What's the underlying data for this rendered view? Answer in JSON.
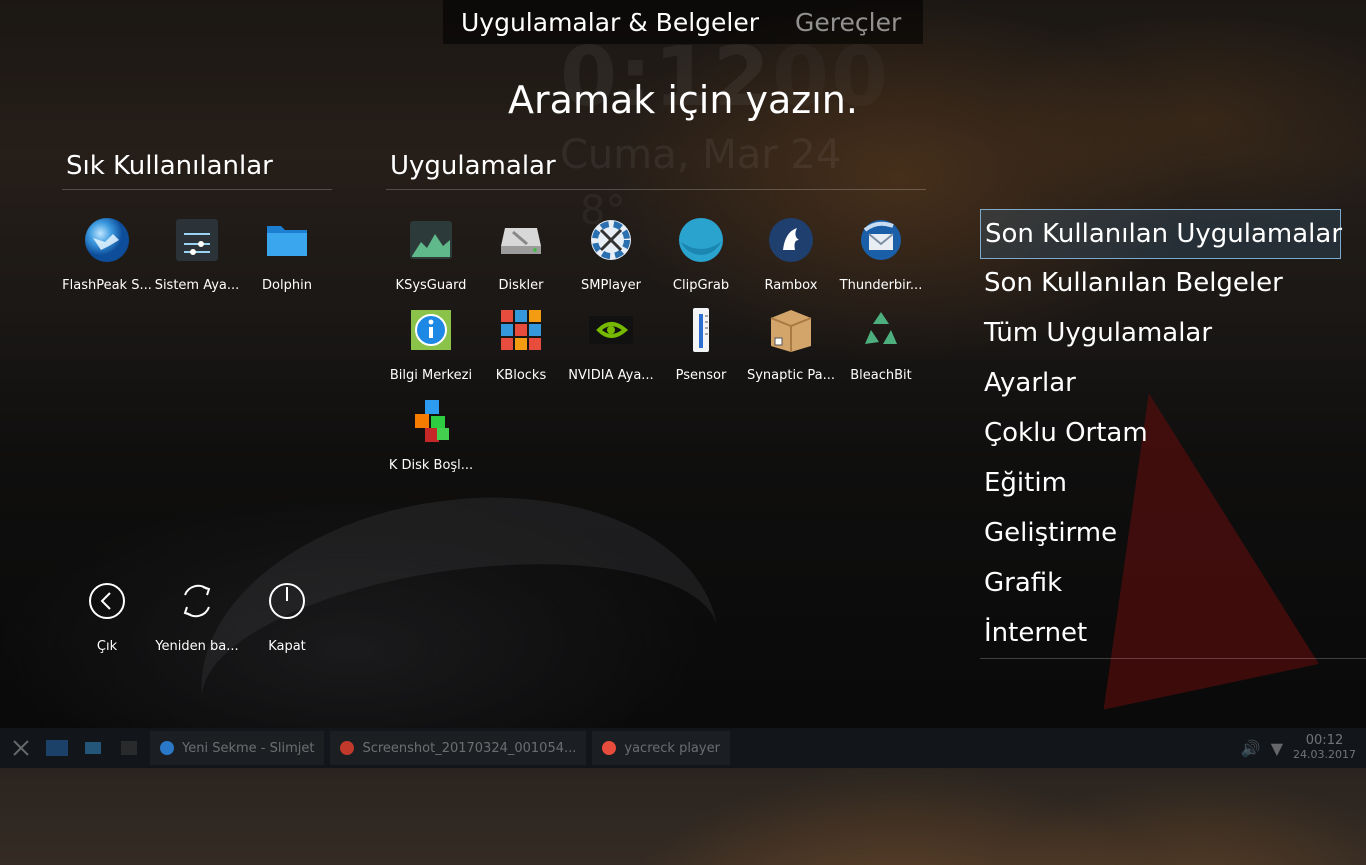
{
  "tabs": [
    {
      "label": "Uygulamalar & Belgeler",
      "active": true
    },
    {
      "label": "Gereçler",
      "active": false
    }
  ],
  "search_hint": "Aramak için yazın.",
  "favorites": {
    "title": "Sık Kullanılanlar",
    "items": [
      {
        "label": "FlashPeak S...",
        "icon": "globe-icon"
      },
      {
        "label": "Sistem Aya...",
        "icon": "settings-sliders-icon"
      },
      {
        "label": "Dolphin",
        "icon": "folder-icon"
      }
    ]
  },
  "apps": {
    "title": "Uygulamalar",
    "items": [
      {
        "label": "KSysGuard",
        "icon": "ksysguard-icon"
      },
      {
        "label": "Diskler",
        "icon": "disk-icon"
      },
      {
        "label": "SMPlayer",
        "icon": "smplayer-icon"
      },
      {
        "label": "ClipGrab",
        "icon": "clipgrab-icon"
      },
      {
        "label": "Rambox",
        "icon": "rambox-icon"
      },
      {
        "label": "Thunderbir...",
        "icon": "thunderbird-icon"
      },
      {
        "label": "Bilgi Merkezi",
        "icon": "info-icon"
      },
      {
        "label": "KBlocks",
        "icon": "kblocks-icon"
      },
      {
        "label": "NVIDIA Aya...",
        "icon": "nvidia-icon"
      },
      {
        "label": "Psensor",
        "icon": "thermometer-icon"
      },
      {
        "label": "Synaptic Pa...",
        "icon": "package-box-icon"
      },
      {
        "label": "BleachBit",
        "icon": "recycle-icon"
      },
      {
        "label": "K Disk Boşl...",
        "icon": "cubes-icon"
      }
    ]
  },
  "categories": [
    {
      "label": "Son Kullanılan Uygulamalar",
      "selected": true
    },
    {
      "label": "Son Kullanılan Belgeler",
      "selected": false
    },
    {
      "label": "Tüm Uygulamalar",
      "selected": false
    },
    {
      "label": "Ayarlar",
      "selected": false
    },
    {
      "label": "Çoklu Ortam",
      "selected": false
    },
    {
      "label": "Eğitim",
      "selected": false
    },
    {
      "label": "Geliştirme",
      "selected": false
    },
    {
      "label": "Grafik",
      "selected": false
    },
    {
      "label": "İnternet",
      "selected": false
    }
  ],
  "power": [
    {
      "label": "Çık",
      "icon": "logout-arrow-icon"
    },
    {
      "label": "Yeniden ba...",
      "icon": "restart-icon"
    },
    {
      "label": "Kapat",
      "icon": "power-icon"
    }
  ],
  "background": {
    "clock": "0:12",
    "clock_faded": "00",
    "date": "Cuma, Mar 24",
    "temp": "8°"
  },
  "taskbar": {
    "tasks": [
      {
        "label": "Yeni Sekme - Slimjet",
        "icon": "browser-icon"
      },
      {
        "label": "Screenshot_20170324_001054...",
        "icon": "screenshot-icon"
      },
      {
        "label": "yacreck player",
        "icon": "media-player-icon"
      }
    ],
    "time": "00:12",
    "date": "24.03.2017"
  },
  "colors": {
    "selected_border": "#8cbee6",
    "panel_bg": "#000000"
  }
}
